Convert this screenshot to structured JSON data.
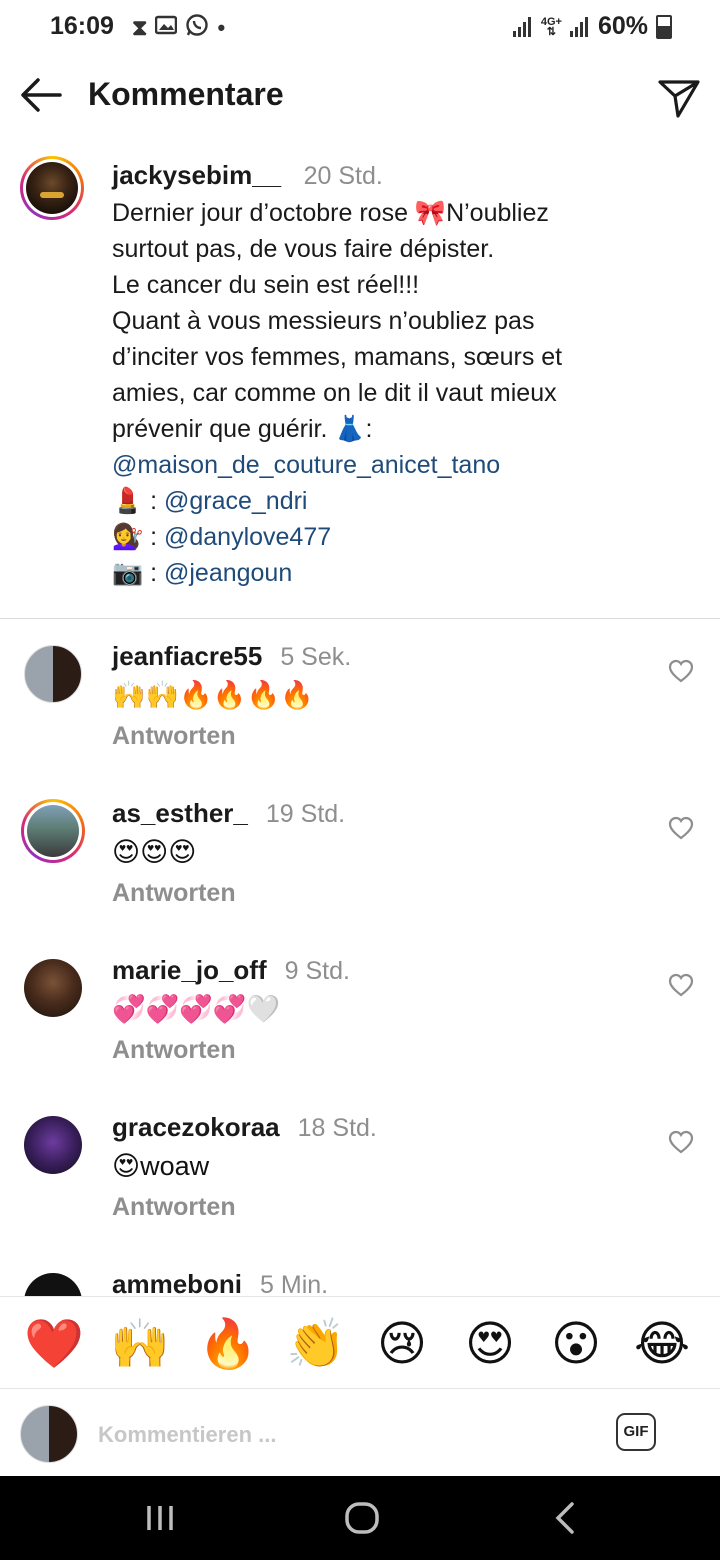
{
  "status": {
    "time": "16:09",
    "net": "4G+",
    "battery": "60%"
  },
  "header": {
    "title": "Kommentare"
  },
  "caption": {
    "username": "jackysebim__",
    "time": "20 Std.",
    "line1a": "Dernier jour d’octobre rose ",
    "line1b": "N’oubliez",
    "line2": "surtout pas, de vous faire dépister.",
    "line3": "Le cancer du sein est réel!!!",
    "line4": "Quant à vous messieurs n’oubliez pas",
    "line5": "d’inciter vos femmes, mamans, sœurs et",
    "line6": "amies, car comme on le dit il vaut mieux",
    "line7": "prévenir que guérir. ",
    "line7b": ":",
    "mention1": "@maison_de_couture_anicet_tano",
    "mention2_prefix": " : ",
    "mention2": "@grace_ndri",
    "mention3_prefix": " : ",
    "mention3": "@danylove477",
    "mention4_prefix": " : ",
    "mention4": "@jeangoun",
    "emoji_bow": "🎀",
    "emoji_dress": "👗",
    "emoji_lipstick": "💄",
    "emoji_hair": "💇‍♀️",
    "emoji_camera": "📷"
  },
  "comments": [
    {
      "username": "jeanfiacre55",
      "time": "5 Sek.",
      "text": "🙌🙌🔥🔥🔥🔥",
      "reply": "Antworten"
    },
    {
      "username": "as_esther_",
      "time": "19 Std.",
      "text": "😍😍😍",
      "reply": "Antworten"
    },
    {
      "username": "marie_jo_off",
      "time": "9 Std.",
      "text": "💞💞💞💞🤍",
      "reply": "Antworten"
    },
    {
      "username": "gracezokoraa",
      "time": "18 Std.",
      "text": "😍woaw",
      "reply": "Antworten"
    },
    {
      "username": "ammeboni",
      "time": "5 Min.",
      "text": "",
      "reply": ""
    }
  ],
  "quick_emojis": [
    "❤️",
    "🙌",
    "🔥",
    "👏",
    "😢",
    "😍",
    "😮",
    "😂"
  ],
  "composer": {
    "placeholder": "Kommentieren ...",
    "gif_label": "GIF"
  }
}
